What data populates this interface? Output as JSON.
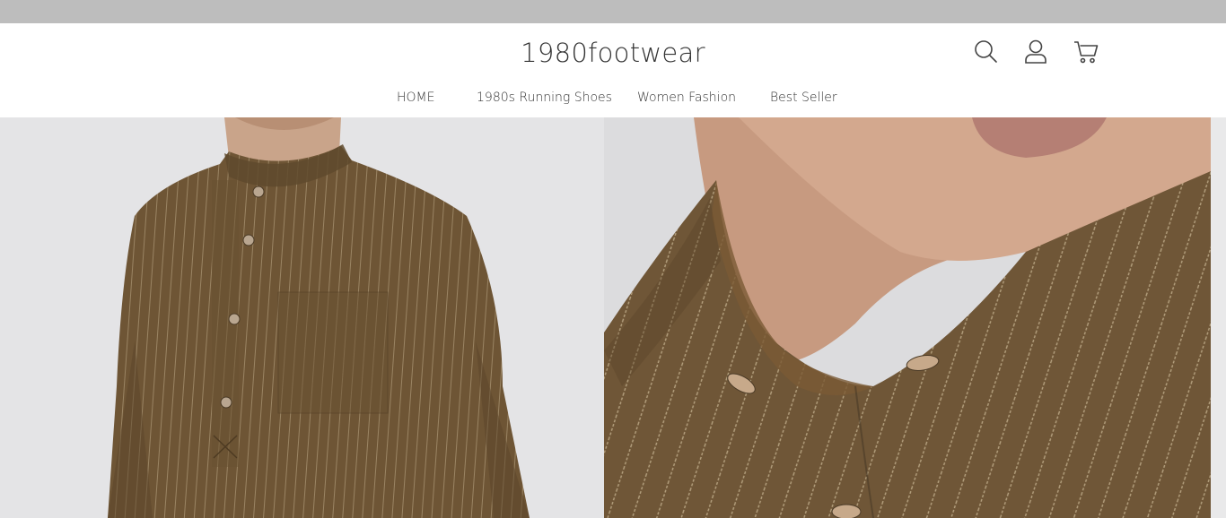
{
  "header": {
    "logo": "1980footwear",
    "icons": [
      "search-icon",
      "account-icon",
      "cart-icon"
    ]
  },
  "nav": {
    "items": [
      {
        "label": "HOME"
      },
      {
        "label": "1980s Running Shoes"
      },
      {
        "label": "Women Fashion"
      },
      {
        "label": "Best Seller"
      }
    ]
  },
  "gallery": {
    "images": [
      {
        "subject": "man in brown pinstripe grandad collar shirt, front view"
      },
      {
        "subject": "close-up of brown pinstripe grandad collar with buttons"
      }
    ]
  },
  "colors": {
    "top_strip": "#bdbdbd",
    "text": "#333333",
    "shirt": "#6e5535",
    "background_photo": "#e6e6e8"
  }
}
